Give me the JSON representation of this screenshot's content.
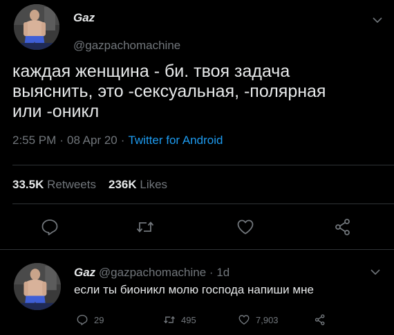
{
  "tweet": {
    "author_name": "Gaz",
    "author_handle": "@gazpachomachine",
    "text": "каждая женщина - би. твоя задача\nвыяснить, это -сексуальная, -полярная\nили -оникл",
    "time": "2:55 PM",
    "date": "08 Apr 20",
    "source": "Twitter for Android",
    "retweets_count": "33.5K",
    "retweets_label": "Retweets",
    "likes_count": "236K",
    "likes_label": "Likes",
    "icons": {
      "caret": "chevron-down-icon",
      "reply": "reply-icon",
      "retweet": "retweet-icon",
      "like": "heart-icon",
      "share": "share-icon"
    }
  },
  "reply": {
    "author_name": "Gaz",
    "author_handle": "@gazpachomachine",
    "time_ago": "1d",
    "text": "если ты бионикл молю господа напиши мне",
    "reply_count": "29",
    "retweet_count": "495",
    "like_count": "7,903"
  },
  "colors": {
    "background": "#000000",
    "text_primary": "#e7e9ea",
    "text_secondary": "#71767b",
    "accent": "#1d9bf0",
    "divider": "#2f3336"
  }
}
